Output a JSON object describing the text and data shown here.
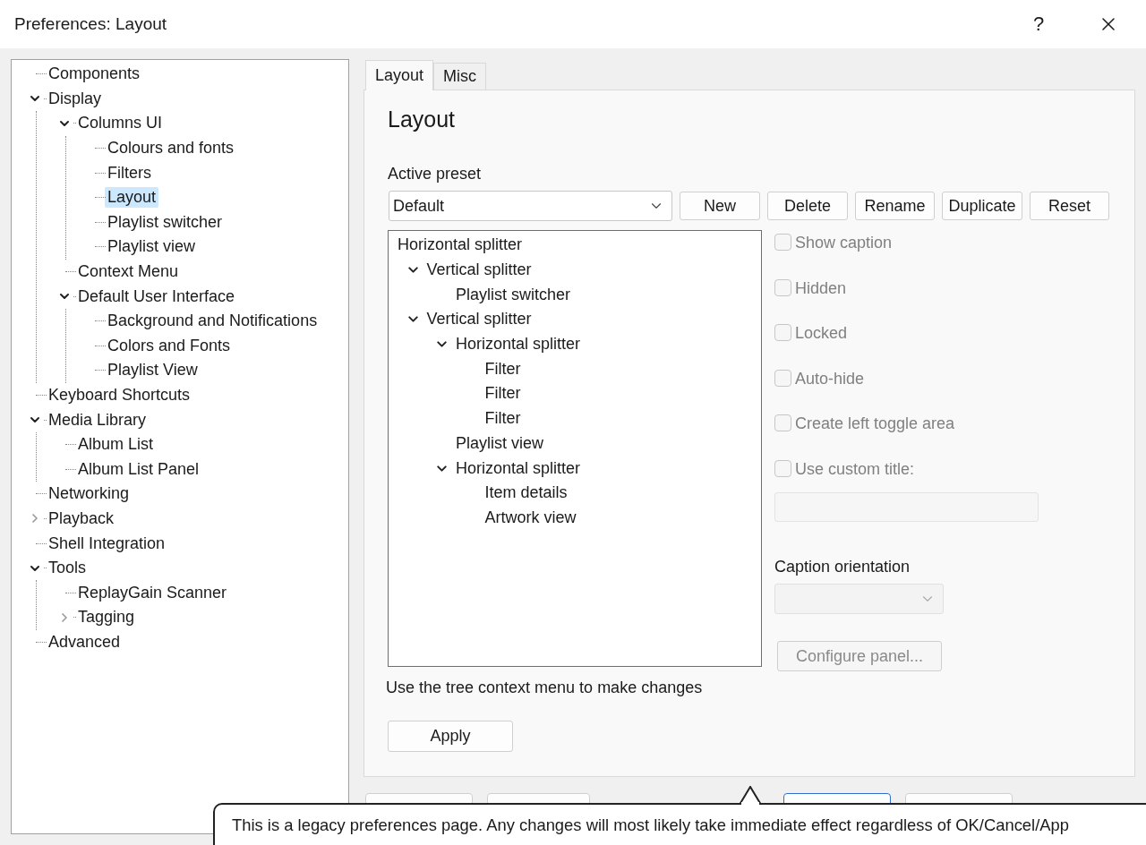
{
  "window": {
    "title": "Preferences: Layout",
    "help_label": "?"
  },
  "nav_tree": [
    {
      "label": "Components",
      "selected": false
    },
    {
      "label": "Display",
      "selected": false,
      "expanded": true,
      "children": [
        {
          "label": "Columns UI",
          "selected": false,
          "expanded": true,
          "children": [
            {
              "label": "Colours and fonts",
              "selected": false
            },
            {
              "label": "Filters",
              "selected": false
            },
            {
              "label": "Layout",
              "selected": true
            },
            {
              "label": "Playlist switcher",
              "selected": false
            },
            {
              "label": "Playlist view",
              "selected": false
            }
          ]
        },
        {
          "label": "Context Menu",
          "selected": false
        },
        {
          "label": "Default User Interface",
          "selected": false,
          "expanded": true,
          "children": [
            {
              "label": "Background and Notifications",
              "selected": false
            },
            {
              "label": "Colors and Fonts",
              "selected": false
            },
            {
              "label": "Playlist View",
              "selected": false
            }
          ]
        }
      ]
    },
    {
      "label": "Keyboard Shortcuts",
      "selected": false
    },
    {
      "label": "Media Library",
      "selected": false,
      "expanded": true,
      "children": [
        {
          "label": "Album List",
          "selected": false
        },
        {
          "label": "Album List Panel",
          "selected": false
        }
      ]
    },
    {
      "label": "Networking",
      "selected": false
    },
    {
      "label": "Playback",
      "selected": false,
      "expanded": false
    },
    {
      "label": "Shell Integration",
      "selected": false
    },
    {
      "label": "Tools",
      "selected": false,
      "expanded": true,
      "children": [
        {
          "label": "ReplayGain Scanner",
          "selected": false
        },
        {
          "label": "Tagging",
          "selected": false,
          "expanded": false
        }
      ]
    },
    {
      "label": "Advanced",
      "selected": false
    }
  ],
  "tabs": [
    {
      "label": "Layout",
      "selected": true
    },
    {
      "label": "Misc",
      "selected": false
    }
  ],
  "page": {
    "heading": "Layout",
    "preset_label": "Active preset",
    "preset_value": "Default",
    "preset_buttons": [
      "New",
      "Delete",
      "Rename",
      "Duplicate",
      "Reset"
    ],
    "layout_tree": [
      {
        "label": "Horizontal splitter",
        "children": [
          {
            "label": "Vertical splitter",
            "expanded": true,
            "children": [
              {
                "label": "Playlist switcher"
              }
            ]
          },
          {
            "label": "Vertical splitter",
            "expanded": true,
            "children": [
              {
                "label": "Horizontal splitter",
                "expanded": true,
                "children": [
                  {
                    "label": "Filter"
                  },
                  {
                    "label": "Filter"
                  },
                  {
                    "label": "Filter"
                  }
                ]
              },
              {
                "label": "Playlist view"
              },
              {
                "label": "Horizontal splitter",
                "expanded": true,
                "children": [
                  {
                    "label": "Item details"
                  },
                  {
                    "label": "Artwork view"
                  }
                ]
              }
            ]
          }
        ]
      }
    ],
    "options": [
      {
        "label": "Show caption",
        "checked": false,
        "disabled": true
      },
      {
        "label": "Hidden",
        "checked": false,
        "disabled": true
      },
      {
        "label": "Locked",
        "checked": false,
        "disabled": true
      },
      {
        "label": "Auto-hide",
        "checked": false,
        "disabled": true
      },
      {
        "label": "Create left toggle area",
        "checked": false,
        "disabled": true
      },
      {
        "label": "Use custom title:",
        "checked": false,
        "disabled": true
      }
    ],
    "caption_orientation_label": "Caption orientation",
    "configure_button": "Configure panel...",
    "hint": "Use the tree context menu to make changes",
    "apply_button": "Apply"
  },
  "footer_buttons": [
    {
      "default": false
    },
    {
      "default": false
    },
    {
      "default": true
    },
    {
      "default": false
    }
  ],
  "tooltip": "This is a legacy preferences page. Any changes will most likely take immediate effect regardless of OK/Cancel/App"
}
